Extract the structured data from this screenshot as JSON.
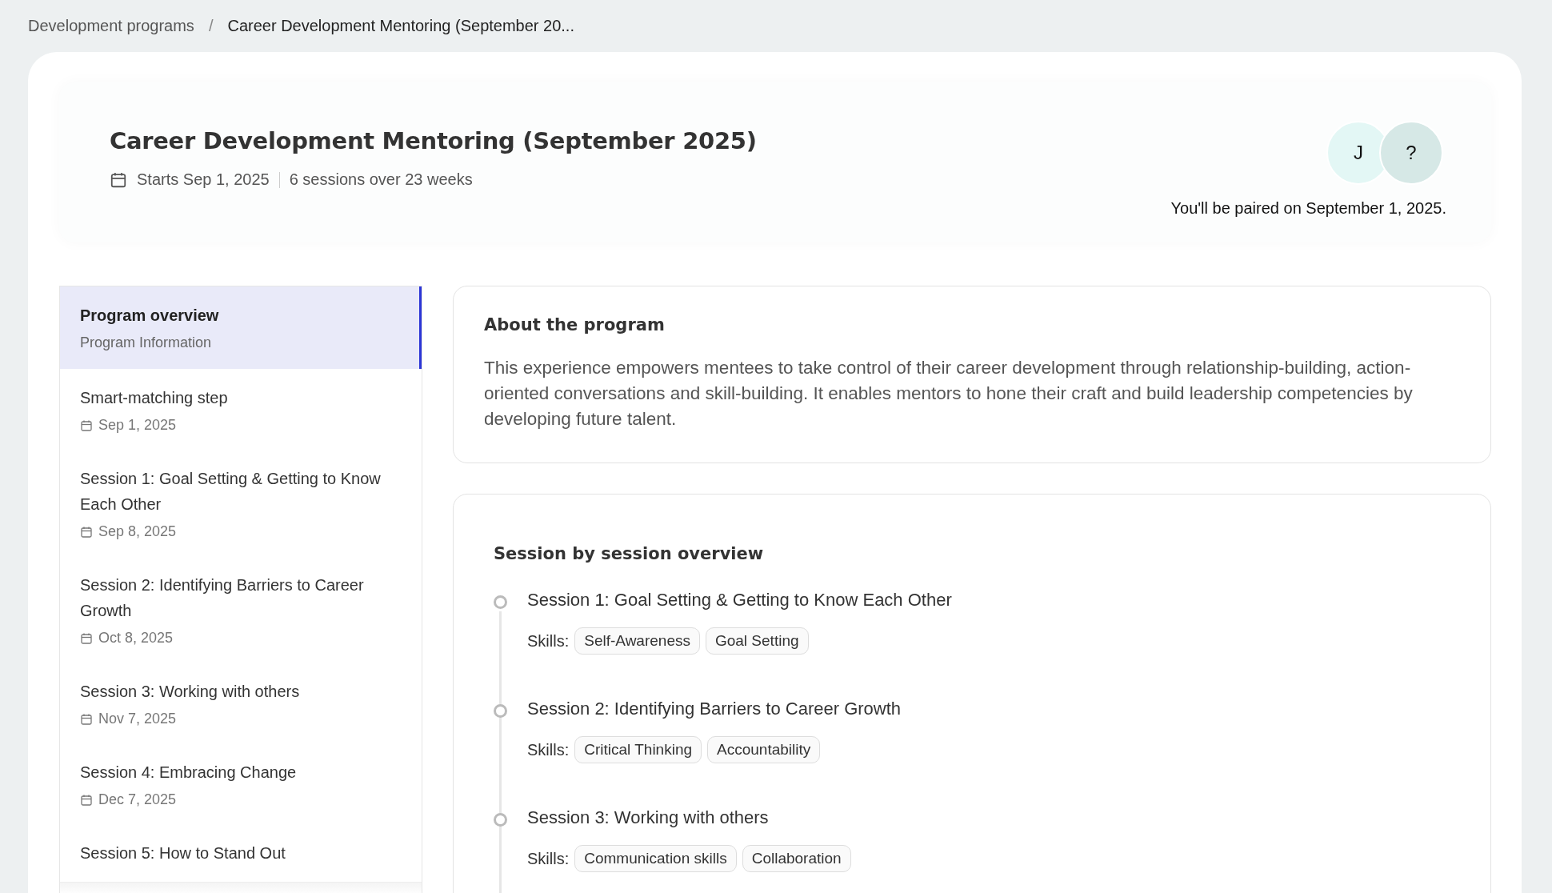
{
  "breadcrumb": [
    {
      "label": "Development programs"
    },
    {
      "separator": "/",
      "label": "Career Development Mentoring (September 20..."
    }
  ],
  "header": {
    "title": "Career Development Mentoring (September 2025)",
    "starts": "Starts Sep 1, 2025",
    "duration": "6 sessions over 23 weeks",
    "avatars": [
      {
        "label": "J",
        "color": "#e3f7f5"
      },
      {
        "label": "?",
        "color": "#d6e8e6"
      }
    ],
    "pairing_note": "You'll be paired on September 1, 2025."
  },
  "sidebar": {
    "items": [
      {
        "title": "Program overview",
        "subtitle": "Program Information",
        "selected": true
      },
      {
        "title": "Smart-matching step",
        "date": "Sep 1, 2025",
        "selected": false
      },
      {
        "title": "Session 1: Goal Setting & Getting to Know Each Other",
        "date": "Sep 8, 2025",
        "selected": false
      },
      {
        "title": "Session 2: Identifying Barriers to Career Growth",
        "date": "Oct 8, 2025",
        "selected": false
      },
      {
        "title": "Session 3: Working with others",
        "date": "Nov 7, 2025",
        "selected": false
      },
      {
        "title": "Session 4: Embracing Change",
        "date": "Dec 7, 2025",
        "selected": false
      },
      {
        "title": "Session 5: How to Stand Out",
        "selected": false
      }
    ]
  },
  "about": {
    "heading": "About the program",
    "text": "This experience empowers mentees to take control of their career development through relationship-building, action-oriented conversations and skill-building. It enables mentors to hone their craft and build leadership competencies by developing future talent."
  },
  "overview": {
    "heading": "Session by session overview",
    "sessions": [
      {
        "title": "Session 1: Goal Setting & Getting to Know Each Other",
        "skills_label": "Skills:",
        "skills": [
          "Self-Awareness",
          "Goal Setting"
        ]
      },
      {
        "title": "Session 2: Identifying Barriers to Career Growth",
        "skills_label": "Skills:",
        "skills": [
          "Critical Thinking",
          "Accountability"
        ]
      },
      {
        "title": "Session 3: Working with others",
        "skills_label": "Skills:",
        "skills": [
          "Communication skills",
          "Collaboration"
        ]
      }
    ]
  }
}
